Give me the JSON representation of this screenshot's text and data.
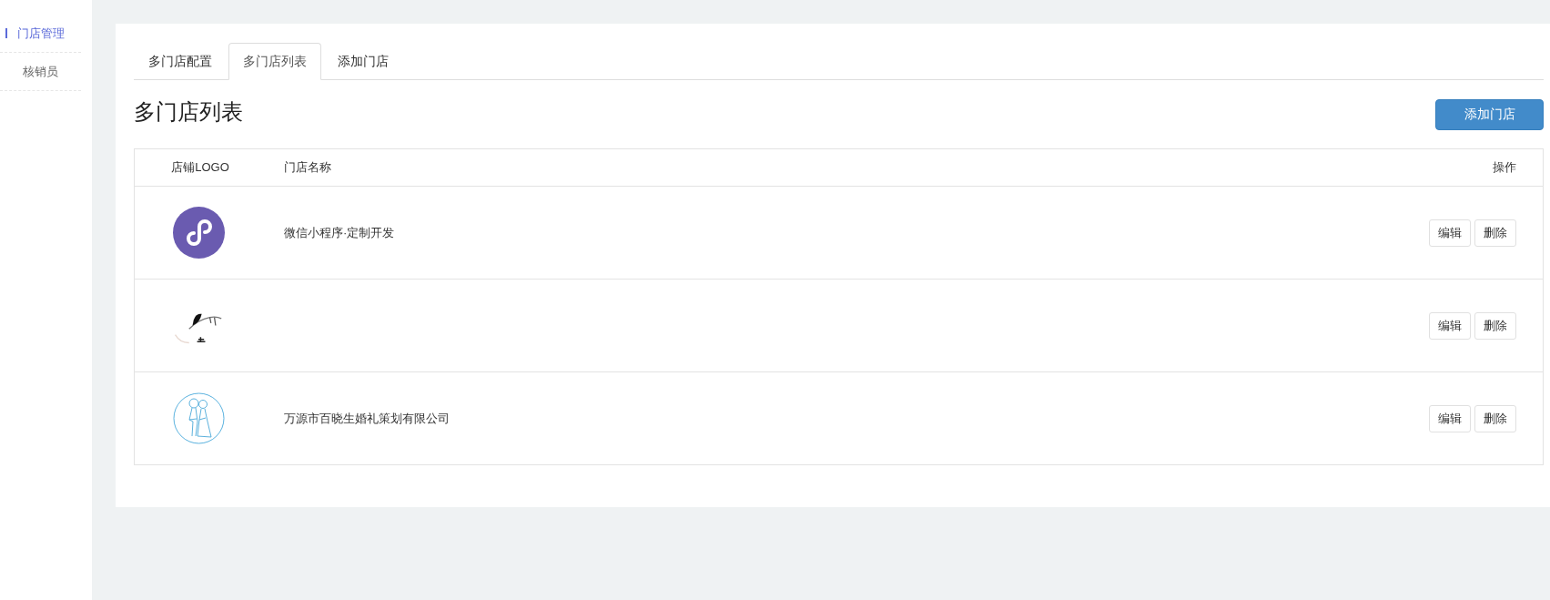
{
  "sidebar": {
    "items": [
      {
        "label": "门店管理",
        "selected": true
      },
      {
        "label": "核销员",
        "selected": false
      }
    ]
  },
  "tabs": [
    {
      "label": "多门店配置",
      "selected": false
    },
    {
      "label": "多门店列表",
      "selected": true
    },
    {
      "label": "添加门店",
      "selected": false
    }
  ],
  "page": {
    "title": "多门店列表",
    "add_button": "添加门店"
  },
  "table": {
    "columns": [
      "店铺LOGO",
      "门店名称",
      "操作"
    ],
    "rows": [
      {
        "logo": {
          "kind": "mini-program"
        },
        "name": "微信小程序·定制开发",
        "actions": [
          "编辑",
          "删除"
        ]
      },
      {
        "logo": {
          "kind": "ink-painting"
        },
        "actions": [
          "编辑",
          "删除"
        ]
      },
      {
        "logo": {
          "kind": "couple-sketch"
        },
        "name": "万源市百晓生婚礼策划有限公司",
        "actions": [
          "编辑",
          "删除"
        ]
      }
    ]
  }
}
